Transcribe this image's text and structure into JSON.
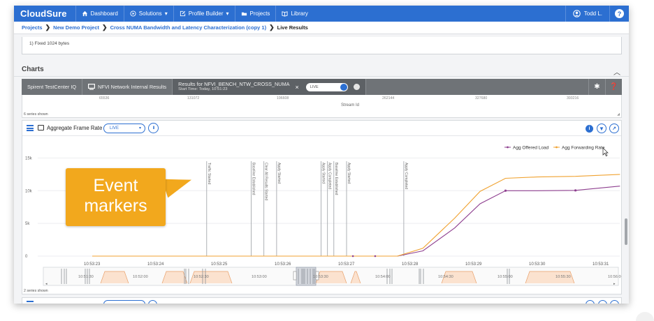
{
  "nav": {
    "brand": "CloudSure",
    "items": [
      {
        "label": "Dashboard",
        "icon": "home-icon"
      },
      {
        "label": "Solutions",
        "icon": "play-circle-icon",
        "dropdown": true
      },
      {
        "label": "Profile Builder",
        "icon": "pencil-icon",
        "dropdown": true
      },
      {
        "label": "Projects",
        "icon": "folder-icon"
      },
      {
        "label": "Library",
        "icon": "book-icon"
      }
    ],
    "user": "Todd L.",
    "help": "?"
  },
  "breadcrumb": {
    "items": [
      "Projects",
      "New Demo Project",
      "Cross NUMA Bandwidth and Latency Characterization (copy 1)"
    ],
    "current": "Live Results"
  },
  "config": {
    "text": "1) Fixed 1024 bytes"
  },
  "charts": {
    "title": "Charts"
  },
  "toolbar": {
    "tab1": "Spirent TestCenter IQ",
    "tab2": "NFVI Network Internal Results",
    "results_title": "Results for NFVI_BENCH_NTW_CROSS_NUMA",
    "results_subtitle": "Start Time: Today, 10:51:23",
    "close": "×",
    "live": "LIVE"
  },
  "prev_chart": {
    "ticks": [
      "65536",
      "131072",
      "196608",
      "262144",
      "327680",
      "393216"
    ],
    "axis_label": "Stream Id",
    "series_shown": "6 series shown"
  },
  "panel": {
    "title": "Aggregate Frame Rate",
    "live_select": "LIVE",
    "pause": "II",
    "series_shown": "2 series shown"
  },
  "callout": {
    "line1": "Event",
    "line2": "markers"
  },
  "chart_data": {
    "type": "line",
    "title": "Aggregate Frame Rate",
    "x": [
      "10:53:23",
      "10:53:24",
      "10:53:25",
      "10:53:26",
      "10:53:27",
      "10:53:28",
      "10:53:29",
      "10:53:30",
      "10:53:31"
    ],
    "ylim": [
      0,
      17500
    ],
    "yticks": [
      0,
      5000,
      10000,
      15000
    ],
    "ytick_labels": [
      "0",
      "5k",
      "10k",
      "15k"
    ],
    "legend_position": "top-right",
    "series": [
      {
        "name": "Agg Offered Load",
        "color": "#8e3f8f",
        "points": [
          [
            "10:53:23",
            0
          ],
          [
            "10:53:24",
            0
          ],
          [
            "10:53:25",
            0
          ],
          [
            "10:53:26",
            0
          ],
          [
            "10:53:27",
            0
          ],
          [
            "10:53:27.8",
            0
          ],
          [
            "10:53:28.2",
            800
          ],
          [
            "10:53:28.7",
            4300
          ],
          [
            "10:53:29.1",
            8000
          ],
          [
            "10:53:29.5",
            10000
          ],
          [
            "10:53:30",
            10000
          ],
          [
            "10:53:30.6",
            10050
          ],
          [
            "10:53:31.3",
            10700
          ]
        ]
      },
      {
        "name": "Agg Forwarding Rate",
        "color": "#f0a230",
        "points": [
          [
            "10:53:23",
            0
          ],
          [
            "10:53:24",
            0
          ],
          [
            "10:53:25",
            0
          ],
          [
            "10:53:26",
            0
          ],
          [
            "10:53:27",
            0
          ],
          [
            "10:53:27.8",
            0
          ],
          [
            "10:53:28.2",
            1200
          ],
          [
            "10:53:28.7",
            5800
          ],
          [
            "10:53:29.1",
            9900
          ],
          [
            "10:53:29.5",
            11900
          ],
          [
            "10:53:30",
            12100
          ],
          [
            "10:53:30.6",
            12200
          ],
          [
            "10:53:31.3",
            12500
          ]
        ]
      }
    ],
    "events": [
      {
        "t": "10:53:24.8",
        "label": "Traffic Started"
      },
      {
        "t": "10:53:25.5",
        "label": "Baseline Established"
      },
      {
        "t": "10:53:25.7",
        "label": "Clear All Results Started"
      },
      {
        "t": "10:53:25.9",
        "label": "Apply Started"
      },
      {
        "t": "10:53:26.6",
        "label": "Apply Started"
      },
      {
        "t": "10:53:26.7",
        "label": "Apply Completed"
      },
      {
        "t": "10:53:26.8",
        "label": "Baseline Established"
      },
      {
        "t": "10:53:27.0",
        "label": "Apply Started"
      },
      {
        "t": "10:53:27.9",
        "label": "Apply Completed"
      }
    ],
    "overview_ticks": [
      "10:51:30",
      "10:52:00",
      "10:52:30",
      "10:53:00",
      "10:53:30",
      "10:54:00",
      "10:54:30",
      "10:55:00",
      "10:55:30",
      "10:56:00"
    ]
  }
}
